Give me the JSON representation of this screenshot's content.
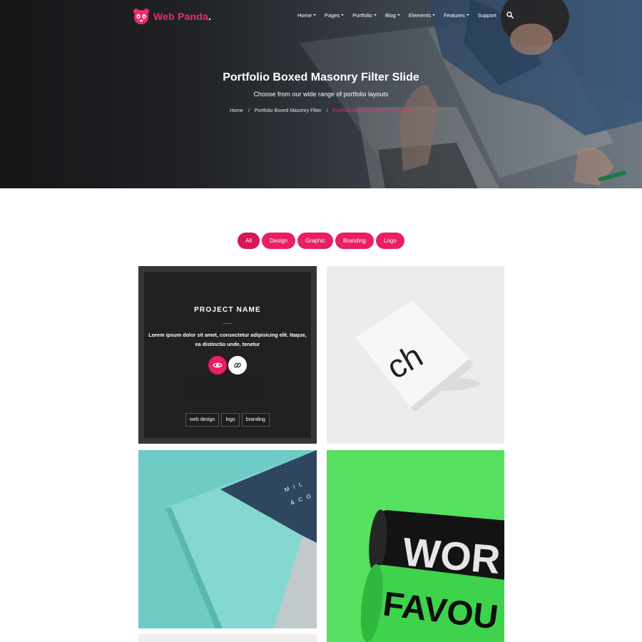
{
  "brand": {
    "name": "Web Panda",
    "accent": "#e91e63",
    "logo_icon": "panda-icon"
  },
  "nav": {
    "items": [
      {
        "label": "Home",
        "has_dropdown": true
      },
      {
        "label": "Pages",
        "has_dropdown": true
      },
      {
        "label": "Portfolio",
        "has_dropdown": true
      },
      {
        "label": "Blog",
        "has_dropdown": true
      },
      {
        "label": "Elements",
        "has_dropdown": true
      },
      {
        "label": "Features",
        "has_dropdown": true
      },
      {
        "label": "Support",
        "has_dropdown": false
      }
    ],
    "search_icon": "search-icon"
  },
  "hero": {
    "title": "Portfolio Boxed Masonry Filter Slide",
    "subtitle": "Choose from our wide range of portfolio layouts",
    "breadcrumb": [
      "Home",
      "Portfolio Boxed Masonry Filter",
      "Portfolio Boxed Masonry Filter Slide"
    ]
  },
  "filters": {
    "items": [
      "All",
      "Design",
      "Graphic",
      "Branding",
      "Logo"
    ],
    "active": "All"
  },
  "portfolio": {
    "featured": {
      "name": "PROJECT NAME",
      "description": "Lorem ipsum dolor sit amet, consectetur adipisicing elit. Itaque, ea distinctio unde, tenetur",
      "view_icon": "eye-icon",
      "link_icon": "link-icon",
      "tags": [
        "web design",
        "logo",
        "branding"
      ]
    },
    "card2_text": "ch",
    "card3_text": [
      "M I L",
      "& C O"
    ],
    "card4_text": [
      "WOR",
      "FAVOU"
    ]
  }
}
